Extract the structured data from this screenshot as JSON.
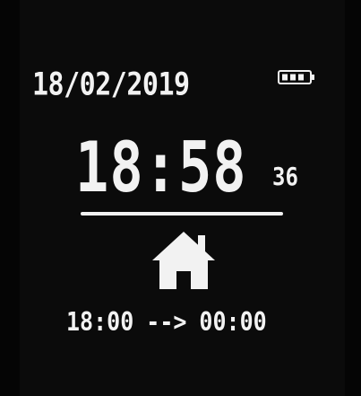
{
  "status_bar": {
    "date": "18/02/2019",
    "battery_icon": "battery-icon"
  },
  "clock": {
    "time": "18:58",
    "seconds": "36"
  },
  "mode": {
    "icon": "home-icon"
  },
  "schedule": {
    "start": "18:00",
    "arrow": "-->",
    "end": "00:00"
  },
  "colors": {
    "background": "#0b0b0b",
    "foreground": "#f2f2f2"
  }
}
